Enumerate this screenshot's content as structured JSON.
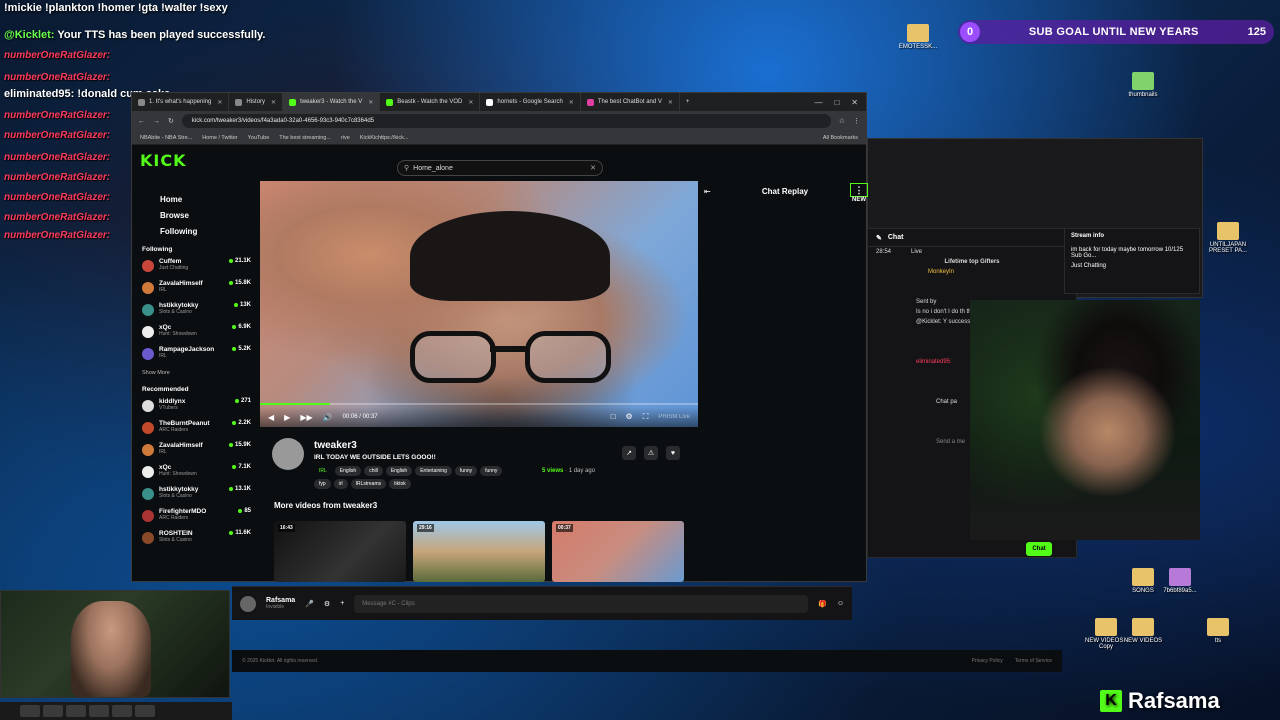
{
  "overlay": {
    "top_text": "!mickie !plankton !homer !gta !walter !sexy",
    "tts_user": "@Kicklet:",
    "tts_message": " Your TTS has been played successfully.",
    "spam_name": "numberOneRatGlazer:",
    "eliminated": "eliminated95: !donald cum cake",
    "subgoal": {
      "count": "0",
      "label": "SUB GOAL UNTIL NEW YEARS",
      "target": "125"
    },
    "brand": "Rafsama",
    "brand_k": "K"
  },
  "desktop_icons": [
    "EMOTESSK...",
    "thumbnails",
    "UNTILJAPAN PRESET PA...",
    "SONGS",
    "7b6bf89a5...",
    "NEW VIDEOS - Copy",
    "NEW VIDEOS",
    "tts"
  ],
  "browser": {
    "tabs": [
      {
        "label": "1. It's what's happening"
      },
      {
        "label": "History"
      },
      {
        "label": "tweaker3 - Watch the V"
      },
      {
        "label": "Beastk - Watch the VOD"
      },
      {
        "label": "hornets - Google Search"
      },
      {
        "label": "The best ChatBot and V"
      }
    ],
    "url": "kick.com/tweaker3/videos/f4a3ada0-32a0-4656-93c3-940c7c8364d5",
    "bookmarks": [
      "NBAbite - NBA Stre...",
      "Home / Twitter",
      "YouTube",
      "The best streaming...",
      "rive",
      "KickKichttps://kick...",
      "All Bookmarks"
    ],
    "window_controls": [
      "—",
      "□",
      "✕"
    ]
  },
  "kick": {
    "logo": "KICK",
    "search_value": "Home_alone",
    "nav": [
      "Home",
      "Browse",
      "Following"
    ],
    "following_title": "Following",
    "following": [
      {
        "name": "Cuffem",
        "cat": "Just Chatting",
        "viewers": "21.1K"
      },
      {
        "name": "ZavalaHimself",
        "cat": "IRL",
        "viewers": "15.8K"
      },
      {
        "name": "hstikkytokky",
        "cat": "Slots & Casino",
        "viewers": "13K"
      },
      {
        "name": "xQc",
        "cat": "Hunt: Showdown",
        "viewers": "6.9K"
      },
      {
        "name": "RampageJackson",
        "cat": "IRL",
        "viewers": "5.2K"
      }
    ],
    "show_more": "Show More",
    "recommended_title": "Recommended",
    "recommended": [
      {
        "name": "kiddlynx",
        "cat": "VTubers",
        "viewers": "271"
      },
      {
        "name": "TheBurntPeanut",
        "cat": "ARC Raiders",
        "viewers": "2.2K"
      },
      {
        "name": "ZavalaHimself",
        "cat": "IRL",
        "viewers": "15.9K"
      },
      {
        "name": "xQc",
        "cat": "Hunt: Showdown",
        "viewers": "7.1K"
      },
      {
        "name": "hstikkytokky",
        "cat": "Slots & Casino",
        "viewers": "13.1K"
      },
      {
        "name": "FirefighterMDO",
        "cat": "ARC Raiders",
        "viewers": "85"
      },
      {
        "name": "ROSHTEIN",
        "cat": "Slots & Casino",
        "viewers": "11.6K"
      }
    ],
    "player": {
      "time": "00:06 / 00:37",
      "progress": 0.16,
      "watermark": "PRISM Live"
    },
    "chat_replay": "Chat Replay",
    "new_badge": "NEW",
    "video": {
      "channel": "tweaker3",
      "title_sub": "IRL TODAY WE OUTSIDE LETS GOOO!!",
      "category": "IRL",
      "tags": [
        "English",
        "chill",
        "English",
        "Entertaining",
        "funny",
        "funny",
        "fyp",
        "irl",
        "IRLstreams",
        "tiktok"
      ],
      "views": "5 views",
      "ago": "1 day ago"
    },
    "more_title": "More videos from tweaker3",
    "thumbs": [
      {
        "dur": "16:43"
      },
      {
        "dur": "29:16"
      },
      {
        "dur": "00:37"
      }
    ]
  },
  "chat_panel": {
    "tab_chat": "Chat",
    "tab_stream": "Stream info",
    "lifetime": "Lifetime top Gifters",
    "gifter": "MonkeyIn",
    "lines": [
      "Sent by",
      "Is no i don't I do th the stream first th",
      "@Kicklet: Y successfully.",
      "eliminated95:",
      "Chat pa",
      "Send a me"
    ],
    "stream_text": "im back for today maybe tomorrow 10/125 Sub Go...",
    "stream_cat": "Just Chatting",
    "chat_btn": "Chat",
    "timer": "28:54",
    "live": "Live"
  },
  "bottom_bar": {
    "user": "Rafsama",
    "status": "Invisible",
    "placeholder": "Message #C - Clips"
  },
  "footer": {
    "copy": "© 2025 Kicklet. All rights reserved.",
    "links": [
      "Privacy Policy",
      "Terms of Service"
    ]
  }
}
